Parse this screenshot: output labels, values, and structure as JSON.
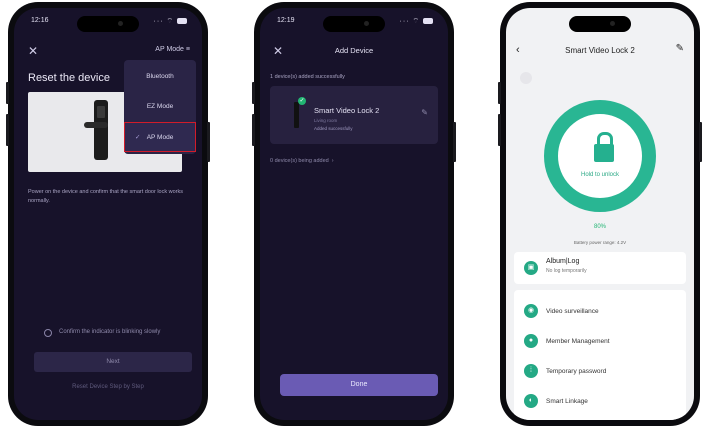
{
  "colors": {
    "dark_bg": "#17122a",
    "accent_teal": "#29b693",
    "highlight_red": "#d11c2a",
    "done_purple": "#6a5bb4"
  },
  "phone1": {
    "time": "12:16",
    "close_icon": "close-icon",
    "mode_label": "AP Mode",
    "title": "Reset the device",
    "description": "Power on the device and confirm that the smart door lock works normally.",
    "dropdown": [
      {
        "label": "Bluetooth",
        "selected": false
      },
      {
        "label": "EZ Mode",
        "selected": false
      },
      {
        "label": "AP Mode",
        "selected": true
      }
    ],
    "confirm_text": "Confirm the indicator is blinking slowly",
    "next_button": "Next",
    "guide_link": "Reset Device Step by Step"
  },
  "phone2": {
    "time": "12:19",
    "title": "Add Device",
    "added_text": "1 device(s) added successfully",
    "device_name": "Smart Video Lock 2",
    "device_sub1": "Living room",
    "device_sub2": "Added successfully",
    "being_added": "0 device(s) being added",
    "done_button": "Done"
  },
  "phone3": {
    "title": "Smart Video Lock 2",
    "hold_text": "Hold to unlock",
    "battery": "80%",
    "battery_desc": "Battery power range: 4.2V",
    "album_title": "Album|Log",
    "album_sub": "No log temporarily",
    "items": [
      {
        "label": "Video surveillance",
        "icon": "video-icon"
      },
      {
        "label": "Member Management",
        "icon": "person-icon"
      },
      {
        "label": "Temporary password",
        "icon": "keypad-icon"
      },
      {
        "label": "Smart Linkage",
        "icon": "toggle-icon"
      }
    ]
  }
}
